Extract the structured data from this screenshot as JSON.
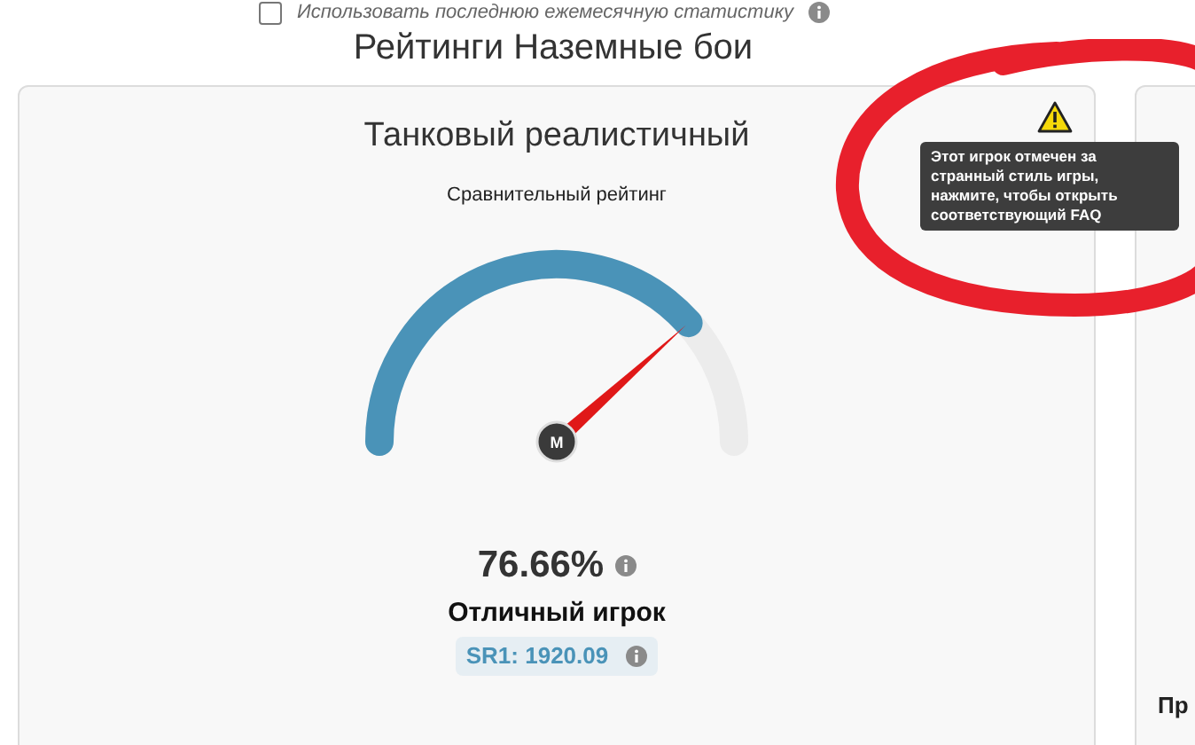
{
  "stats_option": {
    "label": "Использовать последнюю ежемесячную статистику",
    "checked": false
  },
  "title": "Рейтинги Наземные бои",
  "card": {
    "title": "Танковый реалистичный",
    "subtitle": "Сравнительный рейтинг",
    "gauge": {
      "hub": "M"
    },
    "percent": "76.66%",
    "rank": "Отличный игрок",
    "sr": "SR1: 1920.09",
    "flagged": true,
    "tooltip": "Этот игрок отмечен за странный стиль игры, нажмите, чтобы открыть соответствующий FAQ"
  },
  "next_card": {
    "title": "Пр"
  }
}
